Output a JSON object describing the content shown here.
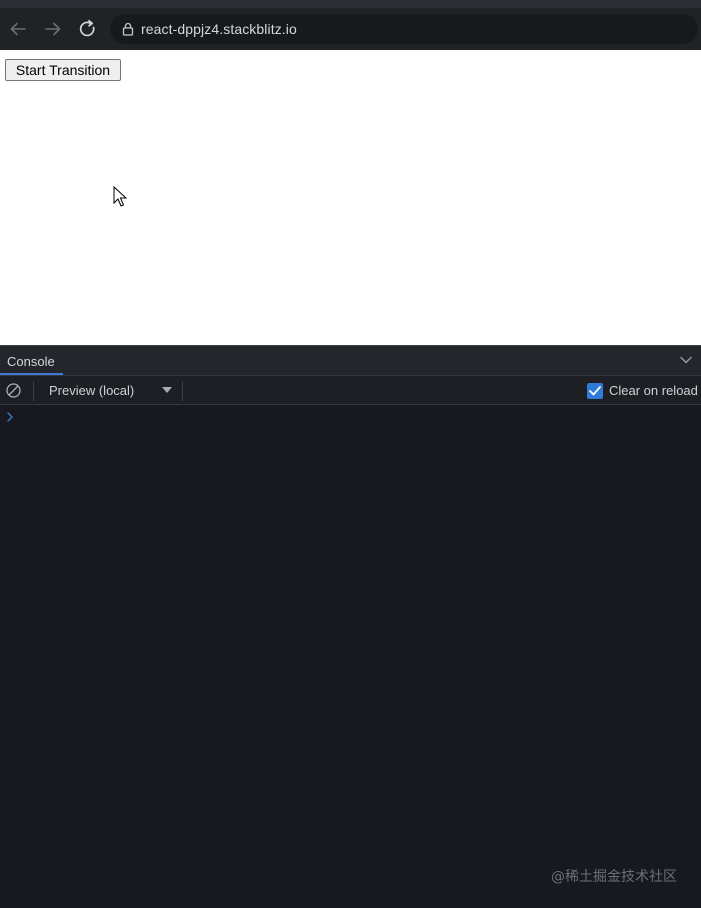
{
  "browser": {
    "url": "react-dppjz4.stackblitz.io"
  },
  "preview": {
    "start_button_label": "Start Transition"
  },
  "console": {
    "tab_label": "Console",
    "context_label": "Preview (local)",
    "clear_on_reload_label": "Clear on reload",
    "clear_on_reload_checked": true
  },
  "watermark": "@稀土掘金技术社区",
  "colors": {
    "accent": "#3f7ad6",
    "checkbox": "#2f7bd8",
    "panel_bg": "#17191e"
  }
}
